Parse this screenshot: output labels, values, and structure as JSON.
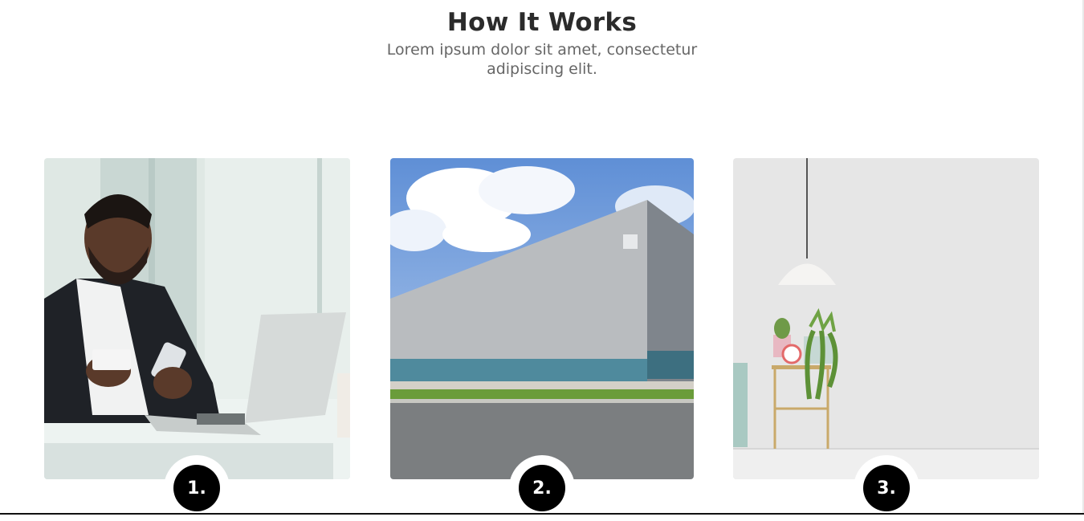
{
  "section": {
    "title": "How It Works",
    "subtitle": "Lorem ipsum dolor sit amet, consectetur adipiscing elit."
  },
  "steps": [
    {
      "number": "1.",
      "image": "man-paying-with-card-at-laptop"
    },
    {
      "number": "2.",
      "image": "modern-warehouse-building"
    },
    {
      "number": "3.",
      "image": "minimal-room-with-lamp-and-plants"
    }
  ],
  "colors": {
    "heading": "#2b2b2b",
    "subtitle": "#666666",
    "step_badge": "#000000"
  }
}
